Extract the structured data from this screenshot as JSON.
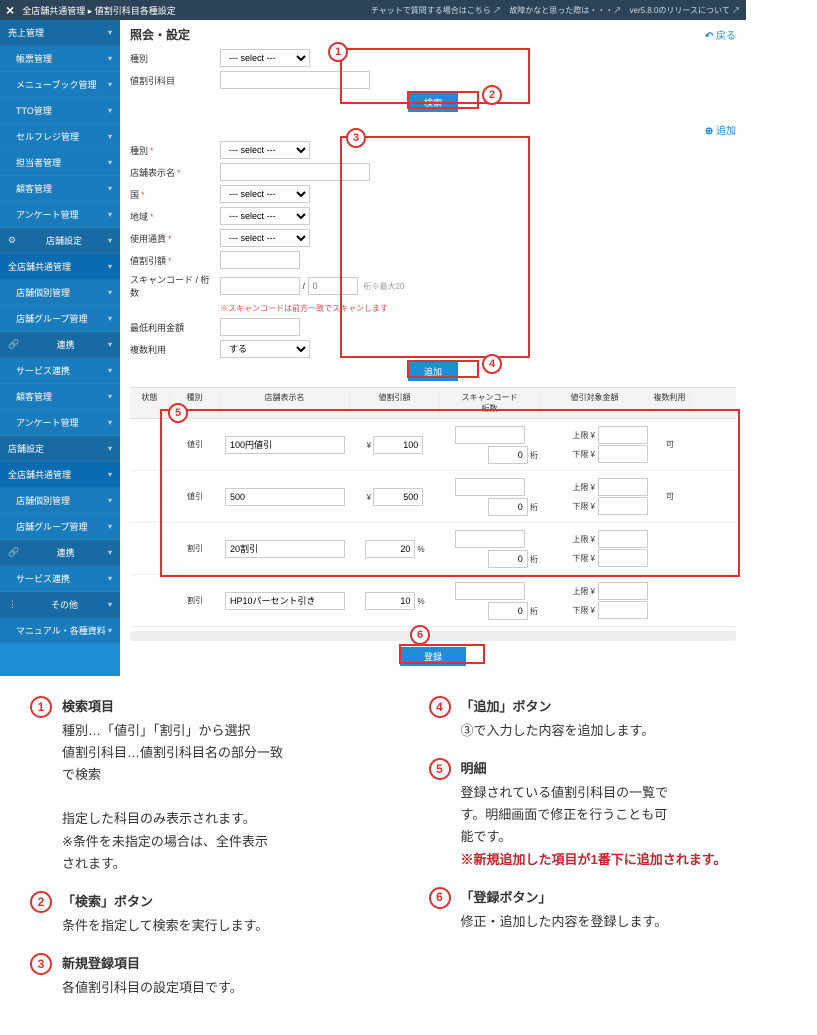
{
  "titlebar": {
    "breadcrumb": "全店舗共通管理 ▸ 値割引科目各種設定",
    "right": [
      "チャットで質問する場合はこちら ↗",
      "故障かなと思った際は・・・↗",
      "ver5.8.0のリリースについて ↗"
    ]
  },
  "sidebar": [
    {
      "label": "売上管理",
      "type": "head"
    },
    {
      "label": "帳票管理",
      "type": "sub"
    },
    {
      "label": "メニューブック管理",
      "type": "sub"
    },
    {
      "label": "TTO管理",
      "type": "sub"
    },
    {
      "label": "セルフレジ管理",
      "type": "sub"
    },
    {
      "label": "担当者管理",
      "type": "sub"
    },
    {
      "label": "顧客管理",
      "type": "sub"
    },
    {
      "label": "アンケート管理",
      "type": "sub"
    },
    {
      "label": "店舗設定",
      "type": "head",
      "icon": "⚙"
    },
    {
      "label": "全店舗共通管理",
      "type": "active"
    },
    {
      "label": "店舗個別管理",
      "type": "sub"
    },
    {
      "label": "店舗グループ管理",
      "type": "sub"
    },
    {
      "label": "連携",
      "type": "head",
      "icon": "🔗"
    },
    {
      "label": "サービス連携",
      "type": "sub"
    },
    {
      "label": "顧客管理",
      "type": "sub"
    },
    {
      "label": "アンケート管理",
      "type": "sub"
    },
    {
      "label": "店舗設定",
      "type": "head2"
    },
    {
      "label": "全店舗共通管理",
      "type": "active"
    },
    {
      "label": "店舗個別管理",
      "type": "sub"
    },
    {
      "label": "店舗グループ管理",
      "type": "sub"
    },
    {
      "label": "連携",
      "type": "head",
      "icon": "🔗"
    },
    {
      "label": "サービス連携",
      "type": "sub"
    },
    {
      "label": "その他",
      "type": "head",
      "icon": "⋮"
    },
    {
      "label": "マニュアル・各種資料",
      "type": "sub"
    }
  ],
  "page": {
    "title": "照会・設定",
    "back": "戻る",
    "addLink": "追加"
  },
  "search": {
    "typeLabel": "種別",
    "typePlaceholder": "--- select ---",
    "itemLabel": "値割引科目",
    "searchBtn": "検索"
  },
  "form": {
    "type": {
      "label": "種別",
      "ph": "--- select ---"
    },
    "displayName": {
      "label": "店舗表示名"
    },
    "country": {
      "label": "国",
      "ph": "--- select ---"
    },
    "region": {
      "label": "地域",
      "ph": "--- select ---"
    },
    "currency": {
      "label": "使用通貨",
      "ph": "--- select ---"
    },
    "amount": {
      "label": "値割引額"
    },
    "scan": {
      "label": "スキャンコード / 桁数",
      "digitPh": "0",
      "note": "桁※最大20",
      "hint": "※スキャンコードは前方一致でスキャンします"
    },
    "minAmount": {
      "label": "最低利用金額"
    },
    "multi": {
      "label": "複数利用",
      "ph": "する"
    },
    "addBtn": "追加"
  },
  "table": {
    "headers": [
      "状態",
      "種別",
      "店舗表示名",
      "値割引額",
      "スキャンコード\n桁数",
      "値引対象金額",
      "複数利用"
    ],
    "rows": [
      {
        "type": "値引",
        "name": "100円値引",
        "amt": "100",
        "unit": "¥",
        "scan": "",
        "digits": "0",
        "upper": "",
        "lower": "",
        "multi": "可"
      },
      {
        "type": "値引",
        "name": "500",
        "amt": "500",
        "unit": "¥",
        "scan": "",
        "digits": "0",
        "upper": "",
        "lower": "",
        "multi": "可"
      },
      {
        "type": "割引",
        "name": "20割引",
        "amt": "20",
        "unit": "%",
        "scan": "",
        "digits": "0",
        "upper": "",
        "lower": "",
        "multi": ""
      },
      {
        "type": "割引",
        "name": "HP10パーセント引き",
        "amt": "10",
        "unit": "%",
        "scan": "",
        "digits": "0",
        "upper": "",
        "lower": "",
        "multi": ""
      }
    ],
    "upperLabel": "上限 ¥",
    "lowerLabel": "下限 ¥",
    "digitsLabel": "桁",
    "registerBtn": "登録"
  },
  "explain": {
    "left": [
      {
        "n": "1",
        "head": "検索項目",
        "body": "種別…「値引」「割引」から選択\n値割引科目…値割引科目名の部分一致\nで検索\n\n指定した科目のみ表示されます。\n※条件を未指定の場合は、全件表示\nされます。"
      },
      {
        "n": "2",
        "head": "「検索」ボタン",
        "body": "条件を指定して検索を実行します。"
      },
      {
        "n": "3",
        "head": "新規登録項目",
        "body": "各値割引科目の設定項目です。"
      }
    ],
    "right": [
      {
        "n": "4",
        "head": "「追加」ボタン",
        "body": "③で入力した内容を追加します。"
      },
      {
        "n": "5",
        "head": "明細",
        "body": "登録されている値割引科目の一覧で\nす。明細画面で修正を行うことも可\n能です。",
        "warn": "※新規追加した項目が1番下に追加されます。"
      },
      {
        "n": "6",
        "head": "「登録ボタン」",
        "body": "修正・追加した内容を登録します。"
      }
    ]
  }
}
